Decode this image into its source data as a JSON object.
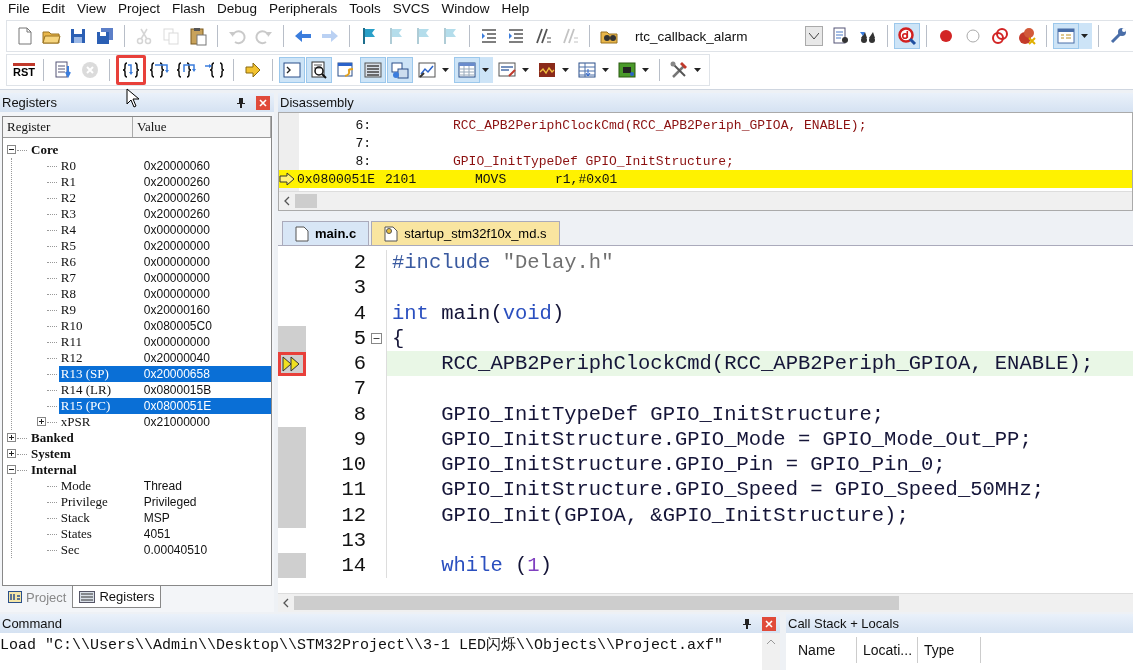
{
  "menu": [
    {
      "label": "File"
    },
    {
      "label": "Edit"
    },
    {
      "label": "View"
    },
    {
      "label": "Project"
    },
    {
      "label": "Flash"
    },
    {
      "label": "Debug"
    },
    {
      "label": "Peripherals"
    },
    {
      "label": "Tools"
    },
    {
      "label": "SVCS"
    },
    {
      "label": "Window"
    },
    {
      "label": "Help"
    }
  ],
  "toolbar_1": {
    "groups": [
      [
        {
          "kind": "new",
          "disabled": false,
          "on": false
        },
        {
          "kind": "open",
          "disabled": false,
          "on": false
        },
        {
          "kind": "save",
          "disabled": false,
          "on": false
        },
        {
          "kind": "saveall",
          "disabled": false,
          "on": false
        }
      ],
      [
        {
          "kind": "cut",
          "disabled": true,
          "on": false
        },
        {
          "kind": "copy",
          "disabled": true,
          "on": false
        },
        {
          "kind": "paste",
          "disabled": false,
          "on": false
        }
      ],
      [
        {
          "kind": "undo",
          "disabled": true,
          "on": false
        },
        {
          "kind": "redo",
          "disabled": true,
          "on": false
        }
      ],
      [
        {
          "kind": "back",
          "disabled": false,
          "on": false
        },
        {
          "kind": "forward",
          "disabled": true,
          "on": false
        }
      ],
      [
        {
          "kind": "bookmark",
          "disabled": false,
          "on": false
        },
        {
          "kind": "bookmark",
          "disabled": true,
          "on": false
        },
        {
          "kind": "bookmark",
          "disabled": true,
          "on": false
        },
        {
          "kind": "bookmark",
          "disabled": true,
          "on": false
        }
      ],
      [
        {
          "kind": "indent",
          "disabled": false,
          "on": false
        },
        {
          "kind": "indent",
          "disabled": false,
          "on": false
        },
        {
          "kind": "comment",
          "disabled": false,
          "on": false
        },
        {
          "kind": "comment",
          "disabled": true,
          "on": false
        }
      ],
      [
        {
          "kind": "findfiles",
          "disabled": false,
          "on": false
        },
        {
          "kind": "combo",
          "value": "rtc_callback_alarm"
        },
        {
          "kind": "find",
          "disabled": false,
          "on": false
        },
        {
          "kind": "incfind",
          "disabled": false,
          "on": false
        }
      ],
      [
        {
          "kind": "debug",
          "disabled": false,
          "on": true
        }
      ],
      [
        {
          "kind": "bp",
          "disabled": false,
          "on": false
        },
        {
          "kind": "bpoff",
          "disabled": false,
          "on": false
        },
        {
          "kind": "bptoggle",
          "disabled": false,
          "on": false
        },
        {
          "kind": "bpkill",
          "disabled": false,
          "on": false
        }
      ],
      [
        {
          "kind": "window",
          "disabled": false,
          "on": true,
          "dropdown": true
        }
      ],
      [
        {
          "kind": "wrench",
          "disabled": false,
          "on": false
        }
      ]
    ]
  },
  "toolbar_2": {
    "groups": [
      [
        {
          "kind": "reset",
          "label": "RST",
          "disabled": false,
          "on": false
        }
      ],
      [
        {
          "kind": "run",
          "disabled": false,
          "on": false
        },
        {
          "kind": "stop",
          "disabled": true,
          "on": false
        }
      ],
      [
        {
          "kind": "stepinto",
          "disabled": false,
          "on": false,
          "marked": true
        },
        {
          "kind": "stepover",
          "disabled": false,
          "on": false
        },
        {
          "kind": "stepout",
          "disabled": false,
          "on": false
        },
        {
          "kind": "runcursor",
          "disabled": false,
          "on": false
        }
      ],
      [
        {
          "kind": "shownext",
          "disabled": false,
          "on": false
        }
      ],
      [
        {
          "kind": "cmd",
          "disabled": false,
          "on": true
        },
        {
          "kind": "disasm",
          "disabled": false,
          "on": true
        },
        {
          "kind": "symbols",
          "disabled": false,
          "on": false
        },
        {
          "kind": "regs",
          "disabled": false,
          "on": true
        },
        {
          "kind": "callstack",
          "disabled": false,
          "on": true
        },
        {
          "kind": "watch",
          "disabled": false,
          "on": false,
          "dropdown": true
        },
        {
          "kind": "memory",
          "disabled": false,
          "on": true,
          "dropdown": true
        },
        {
          "kind": "serial",
          "disabled": false,
          "on": false,
          "dropdown": true
        },
        {
          "kind": "analysis",
          "disabled": false,
          "on": false,
          "dropdown": true
        },
        {
          "kind": "trace",
          "disabled": false,
          "on": false,
          "dropdown": true
        },
        {
          "kind": "sysview",
          "disabled": false,
          "on": false,
          "dropdown": true
        }
      ],
      [
        {
          "kind": "toolbox",
          "disabled": false,
          "on": false,
          "dropdown": true
        }
      ]
    ]
  },
  "registers_panel": {
    "title": "Registers",
    "columns": [
      "Register",
      "Value"
    ],
    "tree": [
      {
        "name": "Core",
        "expanded": true,
        "children": [
          {
            "name": "R0",
            "value": "0x20000060",
            "selected": false
          },
          {
            "name": "R1",
            "value": "0x20000260",
            "selected": false
          },
          {
            "name": "R2",
            "value": "0x20000260",
            "selected": false
          },
          {
            "name": "R3",
            "value": "0x20000260",
            "selected": false
          },
          {
            "name": "R4",
            "value": "0x00000000",
            "selected": false
          },
          {
            "name": "R5",
            "value": "0x20000000",
            "selected": false
          },
          {
            "name": "R6",
            "value": "0x00000000",
            "selected": false
          },
          {
            "name": "R7",
            "value": "0x00000000",
            "selected": false
          },
          {
            "name": "R8",
            "value": "0x00000000",
            "selected": false
          },
          {
            "name": "R9",
            "value": "0x20000160",
            "selected": false
          },
          {
            "name": "R10",
            "value": "0x080005C0",
            "selected": false
          },
          {
            "name": "R11",
            "value": "0x00000000",
            "selected": false
          },
          {
            "name": "R12",
            "value": "0x20000040",
            "selected": false
          },
          {
            "name": "R13 (SP)",
            "value": "0x20000658",
            "selected": true
          },
          {
            "name": "R14 (LR)",
            "value": "0x0800015B",
            "selected": false
          },
          {
            "name": "R15 (PC)",
            "value": "0x0800051E",
            "selected": true
          },
          {
            "name": "xPSR",
            "value": "0x21000000",
            "selected": false,
            "expanded": false
          }
        ],
        "selected": false
      },
      {
        "name": "Banked",
        "expanded": false,
        "selected": false
      },
      {
        "name": "System",
        "expanded": false,
        "selected": false
      },
      {
        "name": "Internal",
        "expanded": true,
        "selected": false,
        "children": [
          {
            "name": "Mode",
            "value": "Thread",
            "selected": false
          },
          {
            "name": "Privilege",
            "value": "Privileged",
            "selected": false
          },
          {
            "name": "Stack",
            "value": "MSP",
            "selected": false
          },
          {
            "name": "States",
            "value": "4051",
            "selected": false
          },
          {
            "name": "Sec",
            "value": "0.00040510",
            "selected": false
          }
        ]
      }
    ],
    "tabs": [
      {
        "label": "Project",
        "kind": "project",
        "selected": false
      },
      {
        "label": "Registers",
        "kind": "registers",
        "selected": true
      }
    ]
  },
  "disassembly": {
    "title": "Disassembly",
    "lines": [
      {
        "kind": "source",
        "number": "6:",
        "text": "RCC_APB2PeriphClockCmd(RCC_APB2Periph_GPIOA, ENABLE);",
        "current": false
      },
      {
        "kind": "source",
        "number": "7:",
        "current": false
      },
      {
        "kind": "source",
        "number": "8:",
        "text": "GPIO_InitTypeDef GPIO_InitStructure;",
        "current": false
      },
      {
        "kind": "instruction",
        "address": "0x0800051E",
        "opcode": "2101",
        "mnemonic": "MOVS",
        "operands": "r1,#0x01",
        "current": true
      }
    ]
  },
  "editor": {
    "tabs": [
      {
        "label": "main.c",
        "kind": "c",
        "selected": true
      },
      {
        "label": "startup_stm32f10x_md.s",
        "kind": "asm",
        "selected": false
      }
    ],
    "lines": [
      {
        "number": "2",
        "executable": false,
        "current": false,
        "segments": [
          {
            "kind": "preprocessor",
            "text": "#include "
          },
          {
            "kind": "string",
            "text": "\"Delay.h\""
          }
        ]
      },
      {
        "number": "3",
        "executable": false,
        "current": false
      },
      {
        "number": "4",
        "executable": false,
        "current": false,
        "segments": [
          {
            "kind": "keyword",
            "text": "int"
          },
          {
            "kind": "plain",
            "text": " main("
          },
          {
            "kind": "keyword",
            "text": "void"
          },
          {
            "kind": "plain",
            "text": ")"
          }
        ]
      },
      {
        "number": "5",
        "executable": true,
        "current": false,
        "expanded": true,
        "segments": [
          {
            "kind": "plain",
            "text": "{"
          }
        ]
      },
      {
        "number": "6",
        "executable": true,
        "current": true,
        "segments": [
          {
            "kind": "plain",
            "text": "    RCC_APB2PeriphClockCmd(RCC_APB2Periph_GPIOA, ENABLE);"
          }
        ]
      },
      {
        "number": "7",
        "executable": false,
        "current": false
      },
      {
        "number": "8",
        "executable": false,
        "current": false,
        "segments": [
          {
            "kind": "plain",
            "text": "    GPIO_InitTypeDef GPIO_InitStructure;"
          }
        ]
      },
      {
        "number": "9",
        "executable": true,
        "current": false,
        "segments": [
          {
            "kind": "plain",
            "text": "    GPIO_InitStructure.GPIO_Mode = GPIO_Mode_Out_PP;"
          }
        ]
      },
      {
        "number": "10",
        "executable": true,
        "current": false,
        "segments": [
          {
            "kind": "plain",
            "text": "    GPIO_InitStructure.GPIO_Pin = GPIO_Pin_0;"
          }
        ]
      },
      {
        "number": "11",
        "executable": true,
        "current": false,
        "segments": [
          {
            "kind": "plain",
            "text": "    GPIO_InitStructure.GPIO_Speed = GPIO_Speed_50MHz;"
          }
        ]
      },
      {
        "number": "12",
        "executable": true,
        "current": false,
        "segments": [
          {
            "kind": "plain",
            "text": "    GPIO_Init(GPIOA, &GPIO_InitStructure);"
          }
        ]
      },
      {
        "number": "13",
        "executable": false,
        "current": false
      },
      {
        "number": "14",
        "executable": true,
        "current": false,
        "segments": [
          {
            "kind": "keyword",
            "text": "    while"
          },
          {
            "kind": "plain",
            "text": " ("
          },
          {
            "kind": "number",
            "text": "1"
          },
          {
            "kind": "plain",
            "text": ")"
          }
        ]
      }
    ]
  },
  "command": {
    "title": "Command",
    "text": "Load \"C:\\\\Users\\\\Admin\\\\Desktop\\\\STM32Project\\\\3-1 LED闪烁\\\\Objects\\\\Project.axf\""
  },
  "call_stack": {
    "title": "Call Stack + Locals",
    "columns": [
      "Name",
      "Locati...",
      "Type"
    ]
  }
}
